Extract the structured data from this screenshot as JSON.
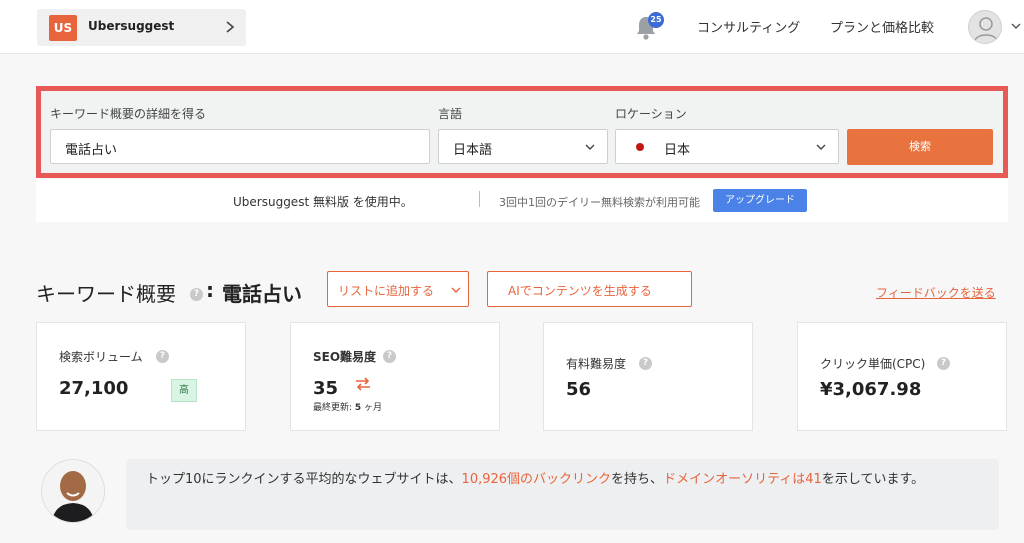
{
  "brand": {
    "logo_text": "US",
    "name": "Ubersuggest",
    "chevron_icon": "chevron-right-icon"
  },
  "nav": {
    "bell_icon": "bell-icon",
    "notification_count": "25",
    "consulting": "コンサルティング",
    "pricing": "プランと価格比較",
    "avatar_icon": "user-avatar-icon"
  },
  "search": {
    "keyword_label": "キーワード概要の詳細を得る",
    "keyword_value": "電話占い",
    "language_label": "言語",
    "language_value": "日本語",
    "location_label": "ロケーション",
    "location_value": "日本",
    "search_button": "検索"
  },
  "usage": {
    "plan_text": "Ubersuggest 無料版 を使用中。",
    "sep": "|",
    "remaining_text": "3回中1回のデイリー無料検索が利用可能",
    "upgrade_button": "アップグレード"
  },
  "overview": {
    "title": "キーワード概要",
    "help": "?",
    "colon": ":",
    "keyword": "電話占い",
    "add_to_list": "リストに追加する",
    "generate_ai": "AIでコンテンツを生成する",
    "feedback": "フィードバックを送る"
  },
  "metrics": {
    "volume": {
      "label": "検索ボリューム",
      "value": "27,100",
      "badge": "高"
    },
    "seo": {
      "label": "SEO難易度",
      "value": "35",
      "updated_prefix": "最終更新: ",
      "updated_num": "5",
      "updated_unit": " ヶ月"
    },
    "paid": {
      "label": "有料難易度",
      "value": "56"
    },
    "cpc": {
      "label": "クリック単価(CPC)",
      "value": "¥3,067.98"
    }
  },
  "tip": {
    "t1": "トップ10にランクインする平均的なウェブサイトは、",
    "h1": "10,926個のバックリンク",
    "t2": "を持ち、",
    "h2": "ドメインオーソリティは41",
    "t3": "を示しています。"
  },
  "colors": {
    "accent": "#e8643c",
    "frame": "#e75a58",
    "upgrade": "#4a82e8",
    "badge_bg": "#3b6bd6"
  }
}
